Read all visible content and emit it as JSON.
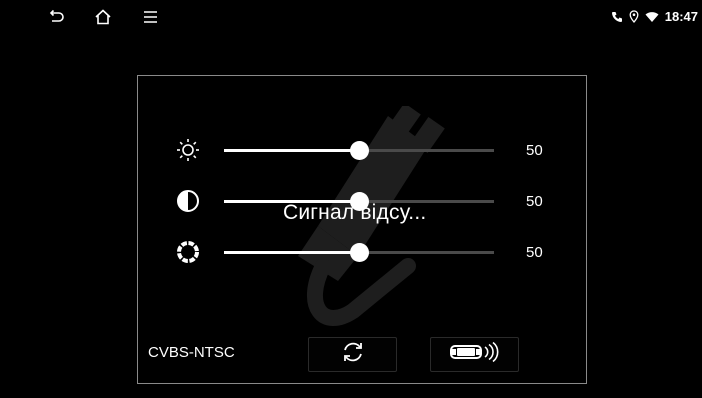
{
  "statusbar": {
    "time": "18:47",
    "nav_icons": [
      "back-icon",
      "home-icon",
      "menu-icon"
    ],
    "status_icons": [
      "phone-icon",
      "location-icon",
      "wifi-icon"
    ]
  },
  "panel": {
    "sliders": [
      {
        "name": "brightness",
        "icon": "brightness-icon",
        "value": "50",
        "level": 0.5
      },
      {
        "name": "contrast",
        "icon": "contrast-icon",
        "value": "50",
        "level": 0.5
      },
      {
        "name": "saturation",
        "icon": "saturation-icon",
        "value": "50",
        "level": 0.5
      }
    ],
    "overlay_text": "Сигнал відсу...",
    "format_label": "CVBS-NTSC",
    "buttons": [
      {
        "icon": "refresh-icon"
      },
      {
        "icon": "parking-sensor-icon"
      }
    ]
  },
  "colors": {
    "background": "#000000",
    "border": "#8a8a8a",
    "track": "#4a4a4a",
    "accent": "#ffffff"
  }
}
